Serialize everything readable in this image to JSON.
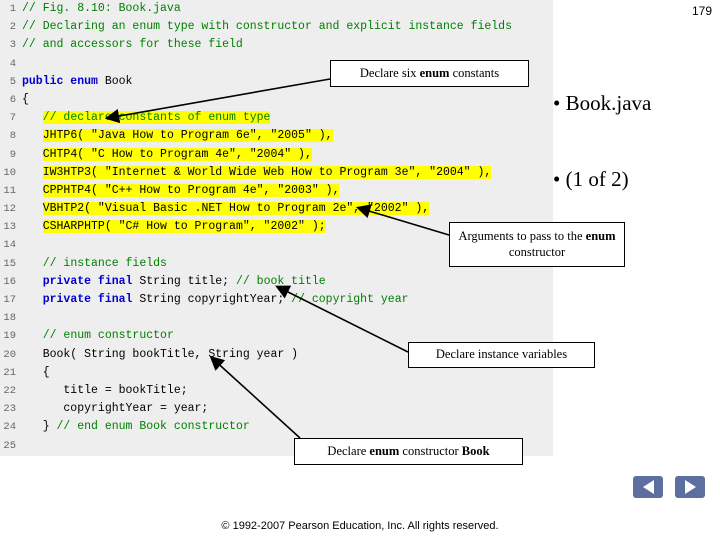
{
  "page_number": "179",
  "footer": "© 1992-2007 Pearson Education, Inc. All rights reserved.",
  "code": {
    "lines": [
      {
        "n": "1",
        "segments": [
          {
            "text": "// Fig. 8.10: Book.java",
            "style": "cmt"
          }
        ]
      },
      {
        "n": "2",
        "segments": [
          {
            "text": "// Declaring an enum type with constructor and explicit instance fields",
            "style": "cmt"
          }
        ]
      },
      {
        "n": "3",
        "segments": [
          {
            "text": "// and accessors for these field",
            "style": "cmt"
          }
        ]
      },
      {
        "n": "4",
        "segments": []
      },
      {
        "n": "5",
        "segments": [
          {
            "text": "public enum",
            "style": "kw"
          },
          {
            "text": " Book",
            "style": "pln"
          }
        ]
      },
      {
        "n": "6",
        "segments": [
          {
            "text": "{",
            "style": "pln"
          }
        ]
      },
      {
        "n": "7",
        "segments": [
          {
            "text": "   ",
            "style": "pln"
          },
          {
            "text": "// declare constants of enum type",
            "style": "hlg"
          }
        ]
      },
      {
        "n": "8",
        "segments": [
          {
            "text": "   ",
            "style": "pln"
          },
          {
            "text": "JHTP6( \"Java How to Program 6e\", \"2005\" ),",
            "style": "hl"
          }
        ]
      },
      {
        "n": "9",
        "segments": [
          {
            "text": "   ",
            "style": "pln"
          },
          {
            "text": "CHTP4( \"C How to Program 4e\", \"2004\" ),",
            "style": "hl"
          }
        ]
      },
      {
        "n": "10",
        "segments": [
          {
            "text": "   ",
            "style": "pln"
          },
          {
            "text": "IW3HTP3( \"Internet & World Wide Web How to Program 3e\", \"2004\" ),",
            "style": "hl"
          }
        ]
      },
      {
        "n": "11",
        "segments": [
          {
            "text": "   ",
            "style": "pln"
          },
          {
            "text": "CPPHTP4( \"C++ How to Program 4e\", \"2003\" ),",
            "style": "hl"
          }
        ]
      },
      {
        "n": "12",
        "segments": [
          {
            "text": "   ",
            "style": "pln"
          },
          {
            "text": "VBHTP2( \"Visual Basic .NET How to Program 2e\", \"2002\" ),",
            "style": "hl"
          }
        ]
      },
      {
        "n": "13",
        "segments": [
          {
            "text": "   ",
            "style": "pln"
          },
          {
            "text": "CSHARPHTP( \"C# How to Program\", \"2002\" );",
            "style": "hl"
          }
        ]
      },
      {
        "n": "14",
        "segments": []
      },
      {
        "n": "15",
        "segments": [
          {
            "text": "   ",
            "style": "pln"
          },
          {
            "text": "// instance fields",
            "style": "cmt"
          }
        ]
      },
      {
        "n": "16",
        "segments": [
          {
            "text": "   ",
            "style": "pln"
          },
          {
            "text": "private final",
            "style": "kw"
          },
          {
            "text": " String title; ",
            "style": "pln"
          },
          {
            "text": "// book title",
            "style": "cmt"
          }
        ]
      },
      {
        "n": "17",
        "segments": [
          {
            "text": "   ",
            "style": "pln"
          },
          {
            "text": "private final",
            "style": "kw"
          },
          {
            "text": " String copyrightYear; ",
            "style": "pln"
          },
          {
            "text": "// copyright year",
            "style": "cmt"
          }
        ]
      },
      {
        "n": "18",
        "segments": []
      },
      {
        "n": "19",
        "segments": [
          {
            "text": "   ",
            "style": "pln"
          },
          {
            "text": "// enum constructor",
            "style": "cmt"
          }
        ]
      },
      {
        "n": "20",
        "segments": [
          {
            "text": "   Book( String bookTitle, String year )",
            "style": "pln"
          }
        ]
      },
      {
        "n": "21",
        "segments": [
          {
            "text": "   {",
            "style": "pln"
          }
        ]
      },
      {
        "n": "22",
        "segments": [
          {
            "text": "      title = bookTitle;",
            "style": "pln"
          }
        ]
      },
      {
        "n": "23",
        "segments": [
          {
            "text": "      copyrightYear = year;",
            "style": "pln"
          }
        ]
      },
      {
        "n": "24",
        "segments": [
          {
            "text": "   } ",
            "style": "pln"
          },
          {
            "text": "// end enum Book constructor",
            "style": "cmt"
          }
        ]
      },
      {
        "n": "25",
        "segments": []
      }
    ]
  },
  "bullets": [
    {
      "text": "• Book.java"
    },
    {
      "text": "• (1 of 2)"
    }
  ],
  "callouts": {
    "constants": {
      "parts": [
        {
          "text": "Declare six ",
          "bold": false
        },
        {
          "text": "enum",
          "bold": true
        },
        {
          "text": " constants",
          "bold": false
        }
      ]
    },
    "arguments": {
      "parts": [
        {
          "text": "Arguments to pass to the ",
          "bold": false
        },
        {
          "text": "enum",
          "bold": true
        },
        {
          "text": " constructor",
          "bold": false
        }
      ]
    },
    "instance": {
      "parts": [
        {
          "text": "Declare instance variables",
          "bold": false
        }
      ]
    },
    "constructor": {
      "parts": [
        {
          "text": "Declare ",
          "bold": false
        },
        {
          "text": "enum",
          "bold": true
        },
        {
          "text": " constructor ",
          "bold": false
        },
        {
          "text": "Book",
          "bold": true
        }
      ]
    }
  },
  "nav": {
    "prev_label": "previous-slide",
    "next_label": "next-slide"
  },
  "colors": {
    "highlight": "#ffff00",
    "comment": "#008000",
    "keyword": "#0000d0",
    "panel_bg": "#eeeeee",
    "nav_button": "#5c6f9e"
  }
}
